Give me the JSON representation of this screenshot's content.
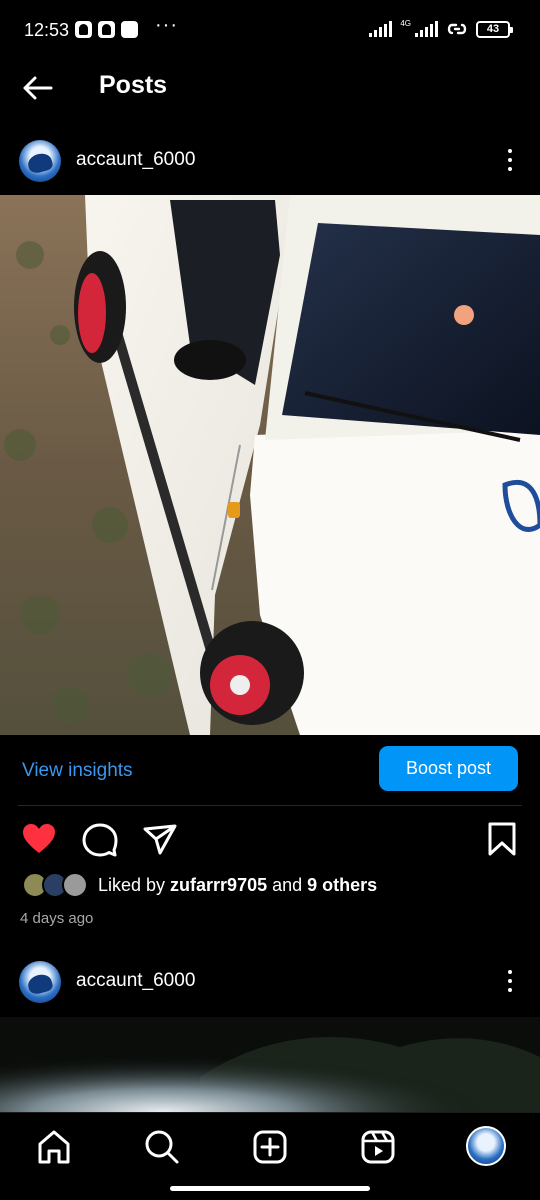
{
  "status_bar": {
    "time": "12:53",
    "network": "4G",
    "battery": "43"
  },
  "header": {
    "back_icon": "arrow-left-icon",
    "title": "Posts"
  },
  "post1": {
    "username": "accaunt_6000",
    "more_icon": "kebab-menu-icon",
    "view_insights": "View insights",
    "boost_post": "Boost post",
    "liked_by_prefix": "Liked by ",
    "liked_by_user": "zufarrr9705",
    "liked_by_and": " and ",
    "liked_by_others": "9 others",
    "time_ago": "4 days ago",
    "liked": true
  },
  "post2": {
    "username": "accaunt_6000"
  },
  "colors": {
    "accent": "#0095f6",
    "link": "#3897f0",
    "like_red": "#ff3040",
    "background": "#000000"
  },
  "bottom_nav": [
    "home-icon",
    "search-icon",
    "create-icon",
    "reels-icon",
    "profile-avatar"
  ]
}
